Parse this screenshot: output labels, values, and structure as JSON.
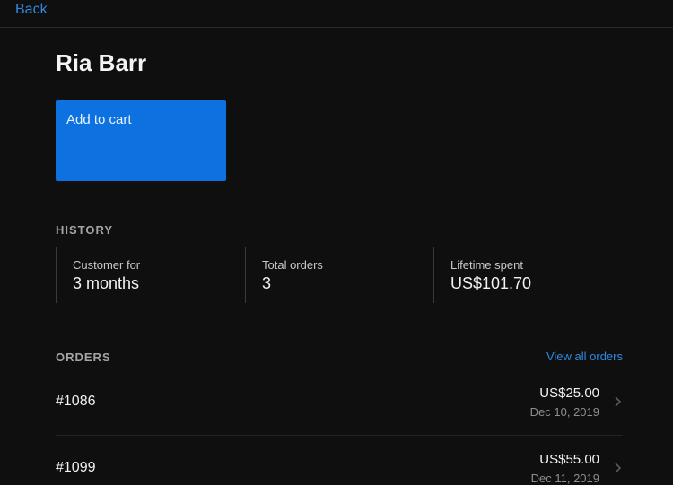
{
  "nav": {
    "back_label": "Back"
  },
  "customer": {
    "name": "Ria Barr"
  },
  "actions": {
    "add_to_cart_label": "Add to cart",
    "accent": "#0d72df"
  },
  "history": {
    "heading": "HISTORY",
    "stats": [
      {
        "label": "Customer for",
        "value": "3 months"
      },
      {
        "label": "Total orders",
        "value": "3"
      },
      {
        "label": "Lifetime spent",
        "value": "US$101.70"
      }
    ]
  },
  "orders": {
    "heading": "ORDERS",
    "view_all_label": "View all orders",
    "items": [
      {
        "id": "#1086",
        "amount": "US$25.00",
        "date": "Dec 10, 2019"
      },
      {
        "id": "#1099",
        "amount": "US$55.00",
        "date": "Dec 11, 2019"
      }
    ],
    "row_icon": "chevron-right-icon"
  },
  "colors": {
    "link": "#2f8ae0",
    "background": "#0f0f10"
  }
}
